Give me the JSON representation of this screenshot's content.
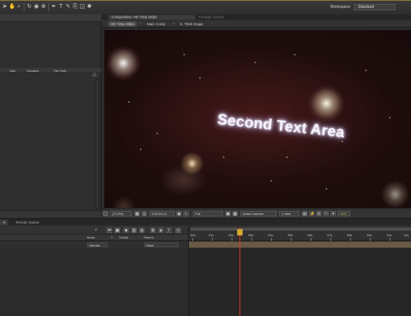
{
  "topbar": {
    "tools": [
      "arrow-tool",
      "hand-tool",
      "zoom-tool",
      "rotate-tool",
      "camera-tool",
      "pan-behind-tool",
      "pen-tool",
      "text-tool",
      "brush-tool",
      "clone-tool",
      "eraser-tool",
      "puppet-tool"
    ],
    "workspace_label": "Workspace:",
    "workspace_value": "Standard"
  },
  "project": {
    "columns": [
      "",
      "Size",
      "Duration",
      "File Path"
    ]
  },
  "composition": {
    "tab_label": "Composition: HD 720p 25fps",
    "footage_tab_label": "Footage: (none)",
    "breadcrumbs": [
      "HD 720p 25fps",
      "Main Comp",
      "6. Third Image"
    ],
    "viewer_text": "Second Text Area",
    "controls": {
      "zoom": "(72.4%)",
      "timecode": "0;00;04;24",
      "resolution": "Full",
      "camera": "Active Camera",
      "views": "1 View",
      "exposure": "+0.0"
    }
  },
  "timeline": {
    "tab_label": "6. Third Image",
    "render_tab_label": "Render Queue",
    "headers": [
      "Mode",
      "T",
      "TrkMat",
      "Parent"
    ],
    "row": {
      "mode": "Normal",
      "parent": "None"
    },
    "ruler_labels": [
      "00s",
      "01s",
      "02s",
      "03s",
      "04s",
      "05s",
      "06s",
      "07s",
      "08s",
      "09s",
      "10s",
      "11s"
    ],
    "playhead_seconds": 4.8
  },
  "colors": {
    "accent_playhead": "#d23a2a",
    "playhead_knob": "#d4a830",
    "layer_bar": "#6b5a46"
  }
}
